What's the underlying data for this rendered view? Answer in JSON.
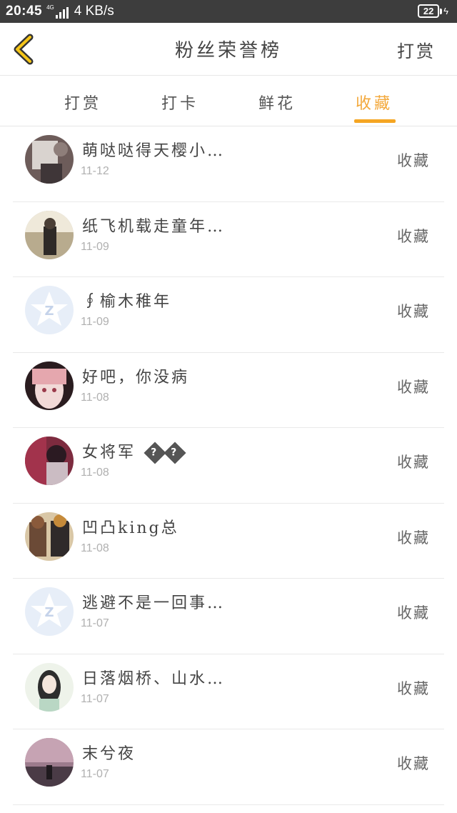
{
  "status_bar": {
    "time": "20:45",
    "network": "4G",
    "speed": "4 KB/s",
    "battery": "22"
  },
  "header": {
    "title": "粉丝荣誉榜",
    "action_label": "打赏"
  },
  "tabs": [
    {
      "label": "打赏"
    },
    {
      "label": "打卡"
    },
    {
      "label": "鲜花"
    },
    {
      "label": "收藏"
    }
  ],
  "active_tab": "收藏",
  "colors": {
    "accent": "#f5a623",
    "status_bar": "#3d3d3d"
  },
  "fans": [
    {
      "name": "萌哒哒得天樱小…",
      "date": "11-12",
      "action": "收藏",
      "avatar": "photo-avatar"
    },
    {
      "name": "纸飞机载走童年…",
      "date": "11-09",
      "action": "收藏",
      "avatar": "photo-avatar"
    },
    {
      "name": "∮榆木稚年",
      "date": "11-09",
      "action": "收藏",
      "avatar": "default-qq-avatar"
    },
    {
      "name": "好吧，你没病",
      "date": "11-08",
      "action": "收藏",
      "avatar": "anime-avatar"
    },
    {
      "name": "女将军",
      "date": "11-08",
      "action": "收藏",
      "avatar": "photo-avatar",
      "suffix_glyphs": "??"
    },
    {
      "name": "凹凸king总",
      "date": "11-08",
      "action": "收藏",
      "avatar": "photo-avatar"
    },
    {
      "name": "逃避不是一回事…",
      "date": "11-07",
      "action": "收藏",
      "avatar": "default-qq-avatar"
    },
    {
      "name": "日落烟桥、山水…",
      "date": "11-07",
      "action": "收藏",
      "avatar": "anime-avatar"
    },
    {
      "name": "末兮夜",
      "date": "11-07",
      "action": "收藏",
      "avatar": "photo-avatar"
    }
  ]
}
